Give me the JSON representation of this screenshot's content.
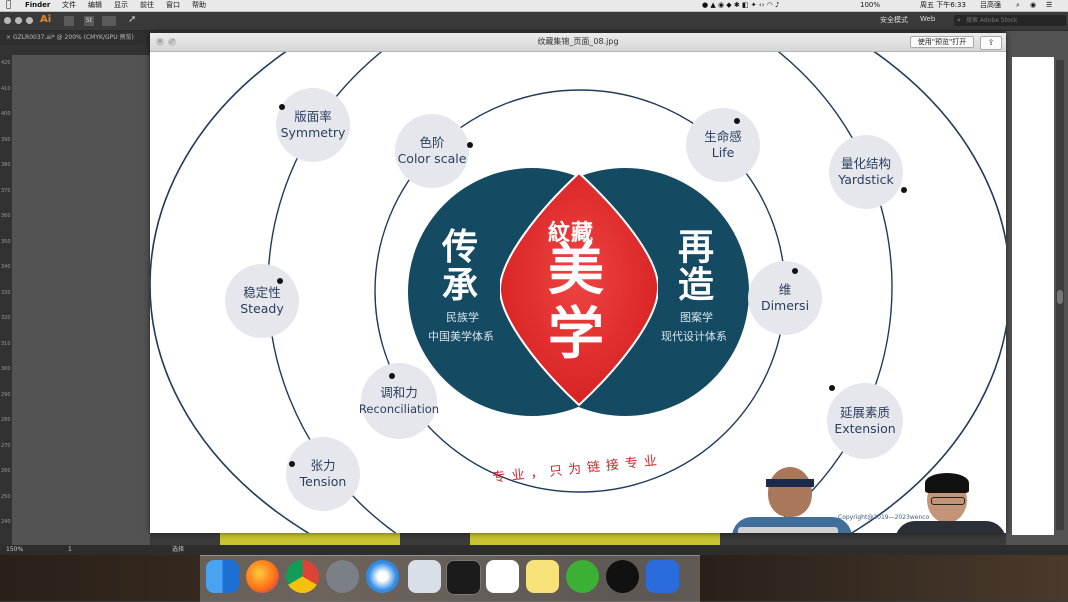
{
  "menubar": {
    "app": "Finder",
    "menus": [
      "文件",
      "编辑",
      "显示",
      "前往",
      "窗口",
      "帮助"
    ],
    "battery": "100%",
    "clock": "周五 下午6:33",
    "user": "吕高强"
  },
  "illustrator": {
    "app_icon": "Ai",
    "doc_tab": "GZLR0037.ai* @ 200% (CMYK/GPU 预览)",
    "workspace": "安全模式",
    "web_label": "Web",
    "search_placeholder": "搜索 Adobe Stock",
    "zoom": "150%",
    "page": "1",
    "status_tool": "选择",
    "ruler_marks": [
      "420",
      "410",
      "400",
      "390",
      "380",
      "370",
      "360",
      "350",
      "340",
      "330",
      "320",
      "310",
      "300",
      "290",
      "280",
      "270",
      "260",
      "250",
      "240"
    ]
  },
  "preview": {
    "title": "纹藏集锦_页面_08.jpg",
    "open_button": "使用\"预览\"打开",
    "share_icon": "share-icon"
  },
  "slide": {
    "left_title": "传承",
    "left_sub1": "民族学",
    "left_sub2": "中国美学体系",
    "center_top": "紋藏",
    "center_main_1": "美",
    "center_main_2": "学",
    "right_title": "再造",
    "right_sub1": "图案学",
    "right_sub2": "现代设计体系",
    "arc_text": "专业，只为链接专业",
    "copyright": "Copyright@2019—2023wenco",
    "nodes": [
      {
        "cn": "版面率",
        "en": "Symmetry"
      },
      {
        "cn": "色阶",
        "en": "Color scale"
      },
      {
        "cn": "生命感",
        "en": "Life"
      },
      {
        "cn": "量化结构",
        "en": "Yardstick"
      },
      {
        "cn": "稳定性",
        "en": "Steady"
      },
      {
        "cn": "维",
        "en": "Dimersi"
      },
      {
        "cn": "调和力",
        "en": "Reconciliation"
      },
      {
        "cn": "延展素质",
        "en": "Extension"
      },
      {
        "cn": "张力",
        "en": "Tension"
      }
    ],
    "colors": {
      "navy": "#154a63",
      "red": "#e02a2a",
      "ring": "#1f3a5a",
      "node_bg": "#e6e7ec",
      "node_text": "#2a3f5f"
    }
  },
  "dock": {
    "apps": [
      "finder-icon",
      "firefox-icon",
      "chrome-icon",
      "launchpad-icon",
      "safari-icon",
      "preview-icon",
      "xcode-icon",
      "terminal-icon",
      "baidu-netdisk-icon",
      "notes-icon",
      "wechat-icon",
      "qq-icon",
      "wps-icon",
      "photoshop-icon"
    ]
  }
}
